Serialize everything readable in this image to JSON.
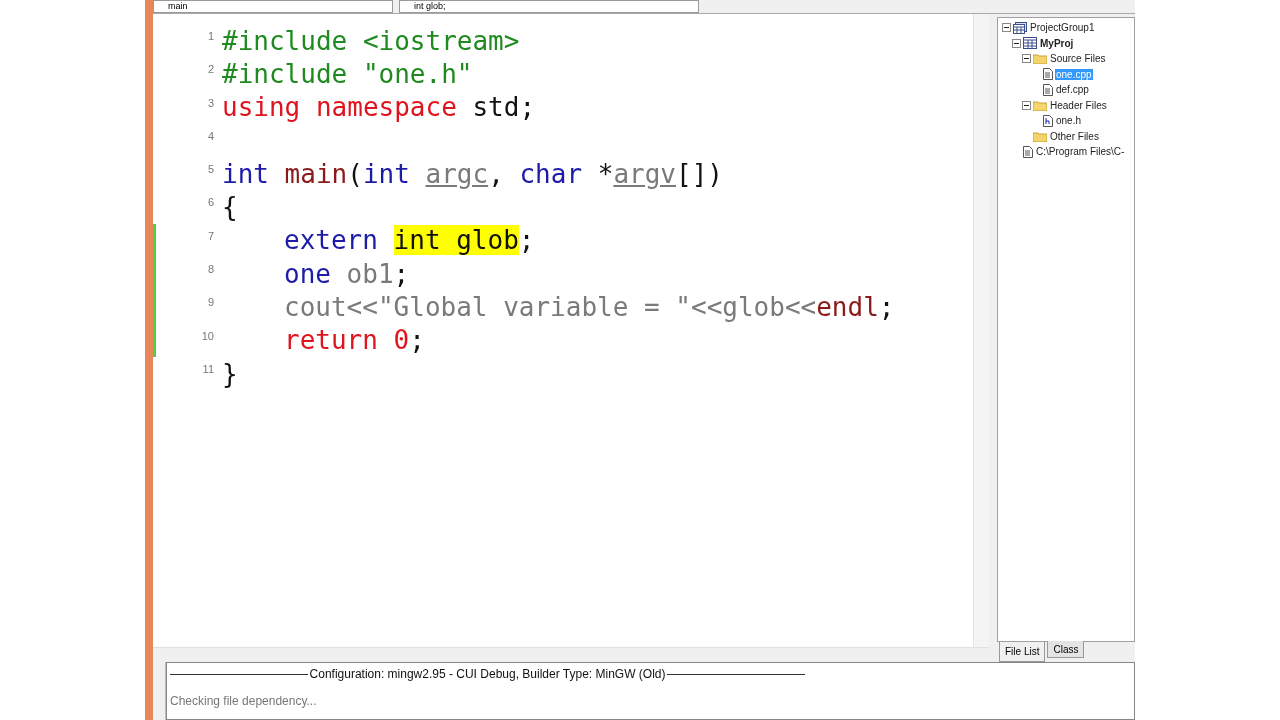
{
  "toolbar": {
    "scope_combo": "main",
    "symbol_combo": "int glob;"
  },
  "editor": {
    "lines": [
      {
        "number": "1",
        "changed": false,
        "indented": false,
        "tokens": [
          {
            "kind": "preprocessor",
            "text": "#include <iostream>"
          }
        ]
      },
      {
        "number": "2",
        "changed": false,
        "indented": false,
        "tokens": [
          {
            "kind": "preprocessor",
            "text": "#include \"one.h\""
          }
        ]
      },
      {
        "number": "3",
        "changed": false,
        "indented": false,
        "tokens": [
          {
            "kind": "reserved",
            "text": "using namespace"
          },
          {
            "kind": "plain",
            "text": " std;"
          }
        ]
      },
      {
        "number": "4",
        "changed": false
      },
      {
        "number": "5",
        "changed": false,
        "indented": false,
        "tokens": [
          {
            "kind": "keyword",
            "text": "int"
          },
          {
            "kind": "function",
            "text": " main"
          },
          {
            "kind": "plain",
            "text": "("
          },
          {
            "kind": "keyword",
            "text": "int "
          },
          {
            "kind": "parameter",
            "text": "argc"
          },
          {
            "kind": "plain",
            "text": ", "
          },
          {
            "kind": "keyword",
            "text": "char"
          },
          {
            "kind": "plain",
            "text": " *"
          },
          {
            "kind": "parameter",
            "text": "argv"
          },
          {
            "kind": "plain",
            "text": "[])"
          }
        ]
      },
      {
        "number": "6",
        "changed": false,
        "indented": false,
        "tokens": [
          {
            "kind": "plain",
            "text": "{"
          }
        ]
      },
      {
        "number": "7",
        "changed": true,
        "indented": true,
        "tokens": [
          {
            "kind": "keyword",
            "text": "extern "
          },
          {
            "kind": "plain",
            "text": "int glob",
            "highlighted": true
          },
          {
            "kind": "plain",
            "text": ";"
          }
        ]
      },
      {
        "number": "8",
        "changed": true,
        "indented": true,
        "tokens": [
          {
            "kind": "keyword",
            "text": "one"
          },
          {
            "kind": "identifier",
            "text": " ob1"
          },
          {
            "kind": "plain",
            "text": ";"
          }
        ]
      },
      {
        "number": "9",
        "changed": true,
        "indented": true,
        "tokens": [
          {
            "kind": "identifier",
            "text": "cout<<\"Global variable = \"<<glob<<"
          },
          {
            "kind": "function",
            "text": "endl"
          },
          {
            "kind": "plain",
            "text": ";"
          }
        ]
      },
      {
        "number": "10",
        "changed": true,
        "indented": true,
        "tokens": [
          {
            "kind": "reserved",
            "text": "return 0"
          },
          {
            "kind": "plain",
            "text": ";"
          }
        ]
      },
      {
        "number": "11",
        "changed": false,
        "indented": false,
        "tokens": [
          {
            "kind": "plain",
            "text": "}"
          }
        ]
      }
    ]
  },
  "project_tree": [
    {
      "label": "ProjectGroup1",
      "kind": "group",
      "expanded": true,
      "selected": false,
      "children": [
        {
          "label": "MyProj",
          "kind": "project",
          "expanded": true,
          "selected": false,
          "children": [
            {
              "label": "Source Files",
              "kind": "folder",
              "expanded": true,
              "selected": false,
              "children": [
                {
                  "label": "one.cpp",
                  "kind": "file",
                  "selected": true
                },
                {
                  "label": "def.cpp",
                  "kind": "file",
                  "selected": false
                }
              ]
            },
            {
              "label": "Header Files",
              "kind": "folder",
              "expanded": true,
              "selected": false,
              "children": [
                {
                  "label": "one.h",
                  "kind": "header",
                  "selected": false
                }
              ]
            },
            {
              "label": "Other Files",
              "kind": "folder",
              "selected": false
            }
          ]
        },
        {
          "label": "C:\\Program Files\\C-",
          "kind": "file",
          "selected": false
        }
      ]
    }
  ],
  "panel_tabs": [
    {
      "label": "File List",
      "selected": true
    },
    {
      "label": "Class",
      "selected": false
    }
  ],
  "output": {
    "header": "Configuration: mingw2.95 - CUI Debug, Builder Type: MinGW (Old)",
    "lines": [
      "Checking file dependency..."
    ]
  }
}
